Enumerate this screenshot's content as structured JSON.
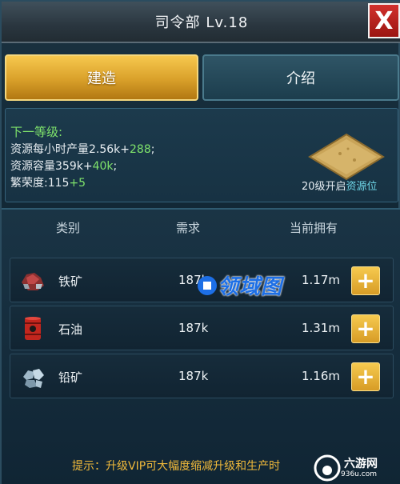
{
  "header": {
    "title": "司令部 Lv.18",
    "close_label": "X"
  },
  "tabs": [
    {
      "label": "建造",
      "active": true
    },
    {
      "label": "介绍",
      "active": false
    }
  ],
  "next_level": {
    "title": "下一等级:",
    "rate_label": "资源每小时产量2.56k+",
    "rate_bonus": "288",
    "rate_suffix": ";",
    "capacity_label": "资源容量359k+",
    "capacity_bonus": "40k",
    "capacity_suffix": ";",
    "prosperity_label": "繁荣度:115",
    "prosperity_bonus": "+5",
    "unlock_prefix": "20级开启",
    "unlock_highlight": "资源位"
  },
  "table": {
    "headers": {
      "category": "类别",
      "required": "需求",
      "owned": "当前拥有"
    },
    "rows": [
      {
        "icon": "iron-ore-icon",
        "name": "铁矿",
        "required": "187k",
        "owned": "1.17m",
        "add": "+"
      },
      {
        "icon": "oil-barrel-icon",
        "name": "石油",
        "required": "187k",
        "owned": "1.31m",
        "add": "+"
      },
      {
        "icon": "lead-ore-icon",
        "name": "铅矿",
        "required": "187k",
        "owned": "1.16m",
        "add": "+"
      }
    ]
  },
  "tip": "提示：升级VIP可大幅度缩减升级和生产时",
  "watermarks": {
    "center": "领域图",
    "corner_main": "六游网",
    "corner_sub": "936u.com"
  },
  "colors": {
    "accent_gold": "#d9a02a",
    "bonus_green": "#7fe36b",
    "highlight_cyan": "#6fd7e8",
    "tip_orange": "#f0b93a"
  }
}
